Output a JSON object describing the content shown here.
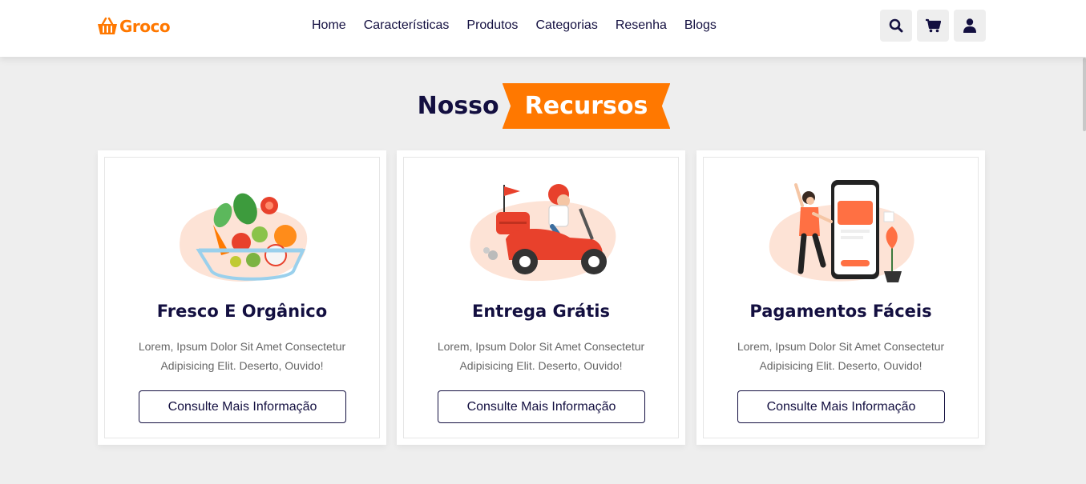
{
  "header": {
    "logo_text": "Groco",
    "nav": [
      "Home",
      "Características",
      "Produtos",
      "Categorias",
      "Resenha",
      "Blogs"
    ],
    "icons": [
      "search-icon",
      "cart-icon",
      "user-icon"
    ]
  },
  "section": {
    "heading_plain": "Nosso",
    "heading_accent": "Recursos"
  },
  "cards": [
    {
      "title": "Fresco E Orgânico",
      "text": "Lorem, Ipsum Dolor Sit Amet Consectetur Adipisicing Elit. Deserto, Ouvido!",
      "button": "Consulte Mais Informação",
      "image": "vegetable-bowl-illustration"
    },
    {
      "title": "Entrega Grátis",
      "text": "Lorem, Ipsum Dolor Sit Amet Consectetur Adipisicing Elit. Deserto, Ouvido!",
      "button": "Consulte Mais Informação",
      "image": "delivery-scooter-illustration"
    },
    {
      "title": "Pagamentos Fáceis",
      "text": "Lorem, Ipsum Dolor Sit Amet Consectetur Adipisicing Elit. Deserto, Ouvido!",
      "button": "Consulte Mais Informação",
      "image": "mobile-payment-illustration"
    }
  ],
  "colors": {
    "accent": "#ff7800",
    "dark": "#130f40",
    "background": "#eeeeee"
  }
}
